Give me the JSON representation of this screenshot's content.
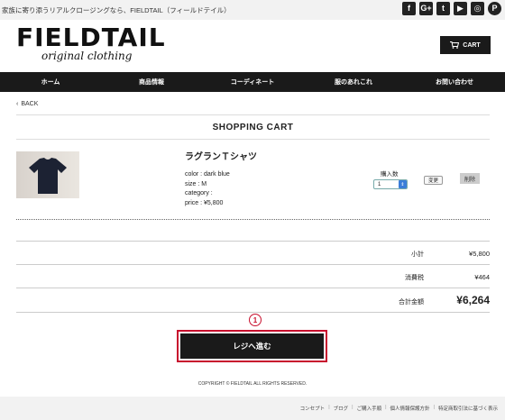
{
  "topbar": {
    "tagline": "家族に寄り添うリアルクロージングなら、FIELDTAIL（フィールドテイル）",
    "social": [
      {
        "icon": "facebook-icon",
        "glyph": "f"
      },
      {
        "icon": "google-plus-icon",
        "glyph": "G+"
      },
      {
        "icon": "twitter-icon",
        "glyph": "t"
      },
      {
        "icon": "youtube-icon",
        "glyph": "▶"
      },
      {
        "icon": "instagram-icon",
        "glyph": "◎"
      },
      {
        "icon": "pinterest-icon",
        "glyph": "P"
      }
    ]
  },
  "brand": {
    "name": "FIELDTAIL",
    "tagline": "original clothing"
  },
  "header": {
    "cart_label": "CART"
  },
  "nav": {
    "items": [
      "ホーム",
      "商品情報",
      "コーディネート",
      "服のあれこれ",
      "お問い合わせ"
    ]
  },
  "back_label": "BACK",
  "page_title": "SHOPPING CART",
  "item": {
    "name": "ラグランＴシャツ",
    "color": "color : dark blue",
    "size": "size : M",
    "category": "category :",
    "price": "price : ¥5,800",
    "qty_label": "購入数",
    "qty_value": "1",
    "change_label": "変更",
    "delete_label": "削除"
  },
  "summary": {
    "subtotal_label": "小計",
    "subtotal_value": "¥5,800",
    "tax_label": "消費税",
    "tax_value": "¥464",
    "total_label": "合計金額",
    "total_value": "¥6,264"
  },
  "annotation": {
    "step": "1"
  },
  "checkout_label": "レジへ進む",
  "copyright": "COPYRIGHT © FIELDTAIL ALL RIGHTS RESERVED.",
  "footer": {
    "links": [
      "コンセプト",
      "ブログ",
      "ご購入手順",
      "個人情報保護方針",
      "特定商取引法に基づく表示"
    ]
  },
  "colors": {
    "accent": "#c8102e",
    "dark": "#1a1a1a",
    "light_bg": "#f2f2f2"
  }
}
